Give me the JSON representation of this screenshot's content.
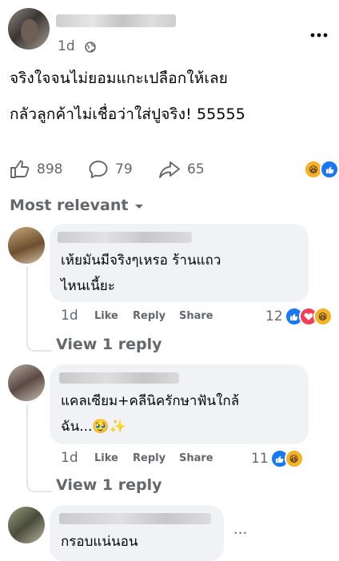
{
  "post": {
    "author_name": "",
    "time": "1d",
    "privacy_icon": "globe-icon",
    "more_icon": "more-horizontal-icon",
    "text_lines": [
      "จริงใจจนไม่ยอมแกะเปลือกให้เลย",
      "กลัวลูกค้าไม่เชื่อว่าใส่ปูจริง! 55555"
    ],
    "likes": "898",
    "comments": "79",
    "shares": "65",
    "reaction_icons": [
      "haha-reaction-icon",
      "like-reaction-icon"
    ]
  },
  "sort": {
    "label": "Most relevant",
    "icon": "caret-down-icon"
  },
  "comments": [
    {
      "author_name": "",
      "text_lines": [
        "เห้ยมันมีจริงๆเหรอ ร้านแถว",
        "ไหนเนี้ยะ"
      ],
      "time": "1d",
      "like_label": "Like",
      "reply_label": "Reply",
      "share_label": "Share",
      "reaction_count": "12",
      "reaction_icons": [
        "like-reaction-icon",
        "love-reaction-icon",
        "haha-reaction-icon"
      ],
      "view_replies": "View 1 reply"
    },
    {
      "author_name": "",
      "text_lines": [
        "แคลเซียม+คลีนิครักษาฟันใกล้",
        "ฉัน...🥹✨"
      ],
      "time": "1d",
      "like_label": "Like",
      "reply_label": "Reply",
      "share_label": "Share",
      "reaction_count": "11",
      "reaction_icons": [
        "like-reaction-icon",
        "haha-reaction-icon"
      ],
      "view_replies": "View 1 reply"
    },
    {
      "author_name": "",
      "text_lines": [
        "กรอบแน่นอน"
      ],
      "more_label": "..."
    }
  ],
  "colors": {
    "like_blue": "#1877f2",
    "love_red": "#f33e58",
    "haha_yellow": "#f7b125",
    "muted_gray": "#65676b",
    "bubble_gray": "#f0f2f5"
  }
}
